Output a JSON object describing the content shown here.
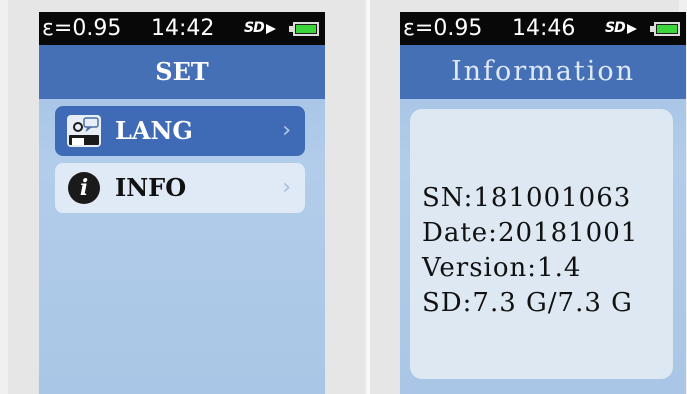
{
  "left_screen": {
    "status": {
      "epsilon": "ε=0.95",
      "time": "14:42",
      "sd_label": "SD",
      "battery_level": 1.0
    },
    "title": "SET",
    "menu": [
      {
        "label": "LANG",
        "icon": "language-icon",
        "selected": true
      },
      {
        "label": "INFO",
        "icon": "info-icon",
        "selected": false
      }
    ]
  },
  "right_screen": {
    "status": {
      "epsilon": "ε=0.95",
      "time": "14:46",
      "sd_label": "SD",
      "battery_level": 1.0
    },
    "title": "Information",
    "info_lines": [
      "SN:181001063",
      "Date:20181001",
      "Version:1.4",
      "SD:7.3 G/7.3 G"
    ]
  },
  "colors": {
    "status_bar": "#080808",
    "title_bar": "#4570b6",
    "selected_item": "#3f6bb6",
    "screen_background": "#a9c6e6",
    "battery": "#3bd43b"
  }
}
